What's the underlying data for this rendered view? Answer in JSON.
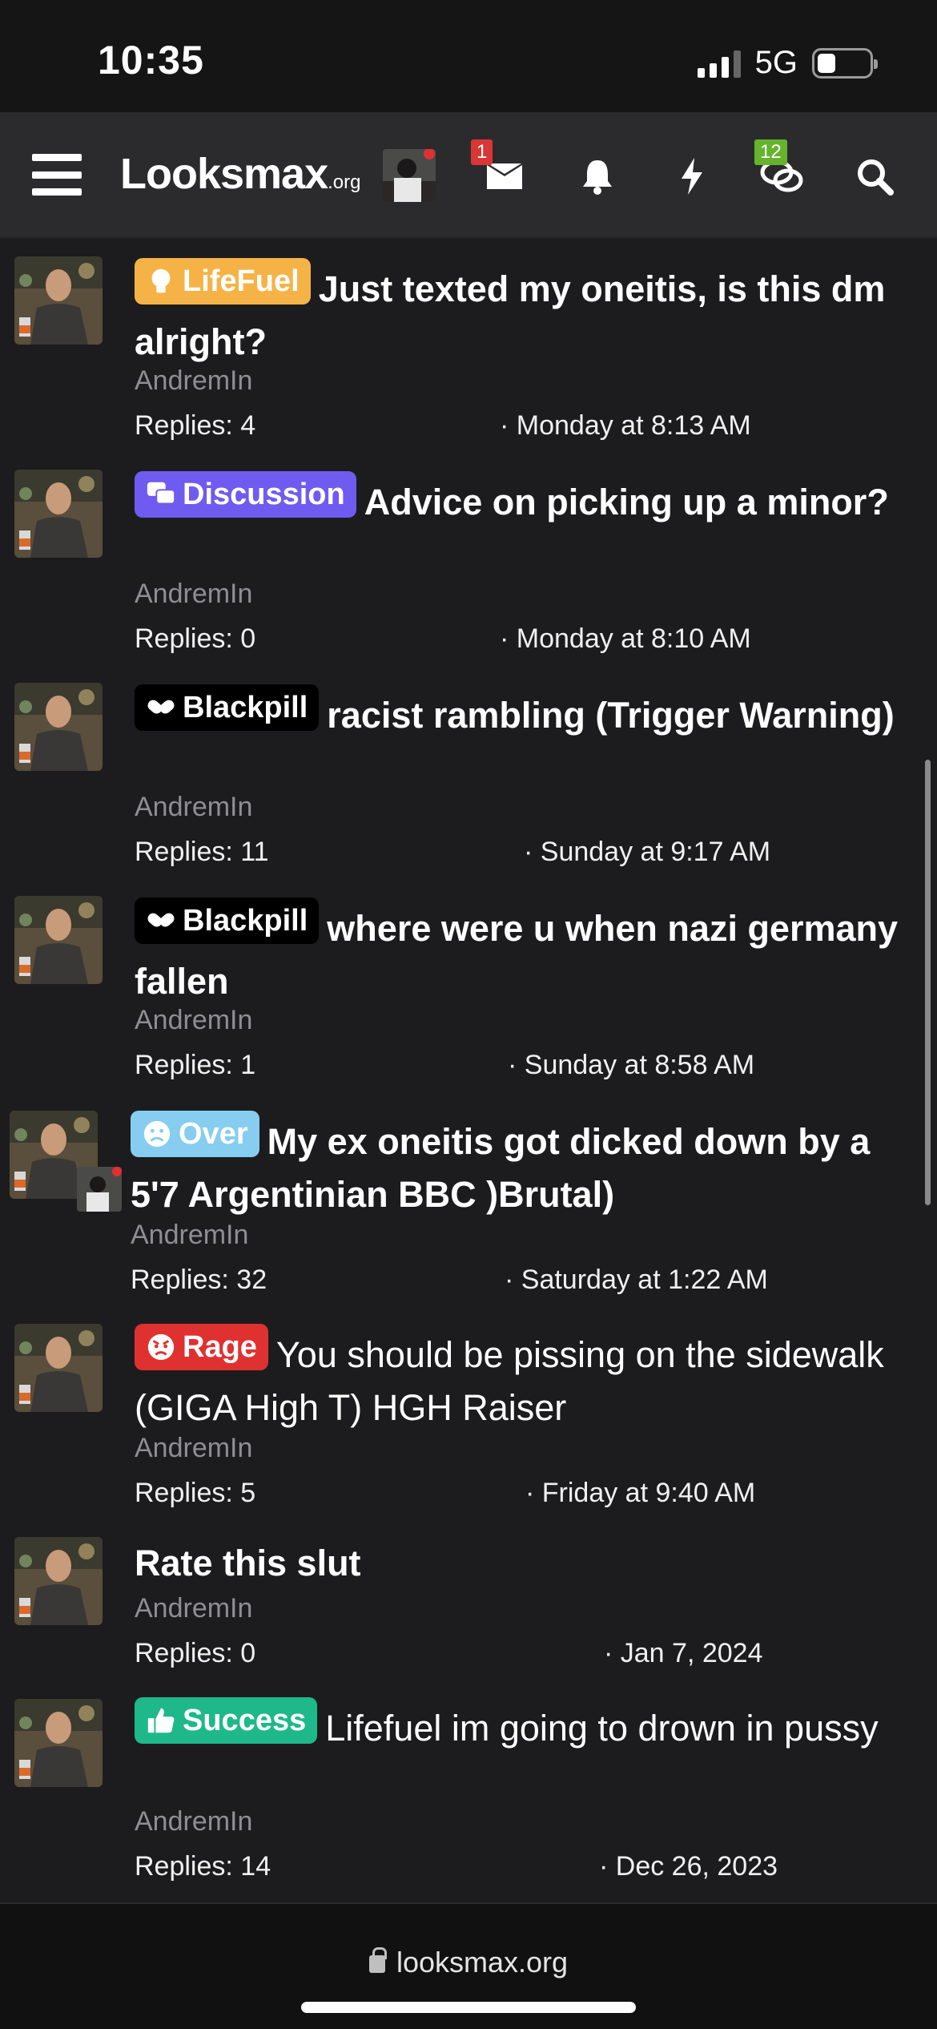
{
  "status_bar": {
    "time": "10:35",
    "network": "5G"
  },
  "nav": {
    "logo_main": "Looksmax",
    "logo_suffix": ".org",
    "messages_badge": "1",
    "conversations_badge": "12"
  },
  "threads": [
    {
      "label": "LifeFuel",
      "label_color": "#f5b347",
      "label_icon": "bulb-icon",
      "title": "Just texted my oneitis, is this dm alright?",
      "title_bold": true,
      "author": "AndremIn",
      "replies": "Replies: 4",
      "date": "· Monday at 8:13 AM"
    },
    {
      "label": "Discussion",
      "label_color": "#6f5bf0",
      "label_icon": "chat-bubbles-icon",
      "title": "Advice on picking up a minor?",
      "title_bold": true,
      "author": "AndremIn",
      "replies": "Replies: 0",
      "date": "· Monday at 8:10 AM"
    },
    {
      "label": "Blackpill",
      "label_color": "#000000",
      "label_icon": "pills-icon",
      "title": "racist rambling (Trigger Warning)",
      "title_bold": true,
      "author": "AndremIn",
      "replies": "Replies: 11",
      "date": "· Sunday at 9:17 AM"
    },
    {
      "label": "Blackpill",
      "label_color": "#000000",
      "label_icon": "pills-icon",
      "title": "where were u when nazi germany fallen",
      "title_bold": true,
      "author": "AndremIn",
      "replies": "Replies: 1",
      "date": "· Sunday at 8:58 AM"
    },
    {
      "label": "Over",
      "label_color": "#86cdf0",
      "label_icon": "sad-face-icon",
      "title": "My ex oneitis got dicked down by a 5'7 Argentinian BBC )Brutal)",
      "title_bold": true,
      "author": "AndremIn",
      "replies": "Replies: 32",
      "date": "· Saturday at 1:22 AM"
    },
    {
      "label": "Rage",
      "label_color": "#e03131",
      "label_icon": "angry-face-icon",
      "title": "You should be pissing on the sidewalk (GIGA High T) HGH Raiser",
      "title_bold": false,
      "author": "AndremIn",
      "replies": "Replies: 5",
      "date": "· Friday at 9:40 AM"
    },
    {
      "label": "",
      "label_color": "",
      "label_icon": "",
      "title": "Rate this slut",
      "title_bold": true,
      "author": "AndremIn",
      "replies": "Replies: 0",
      "date": "· Jan 7, 2024"
    },
    {
      "label": "Success",
      "label_color": "#1fb88a",
      "label_icon": "thumbs-up-icon",
      "title": "Lifefuel im going to drown in pussy",
      "title_bold": false,
      "author": "AndremIn",
      "replies": "Replies: 14",
      "date": "· Dec 26, 2023"
    }
  ],
  "browser": {
    "url": "looksmax.org"
  }
}
